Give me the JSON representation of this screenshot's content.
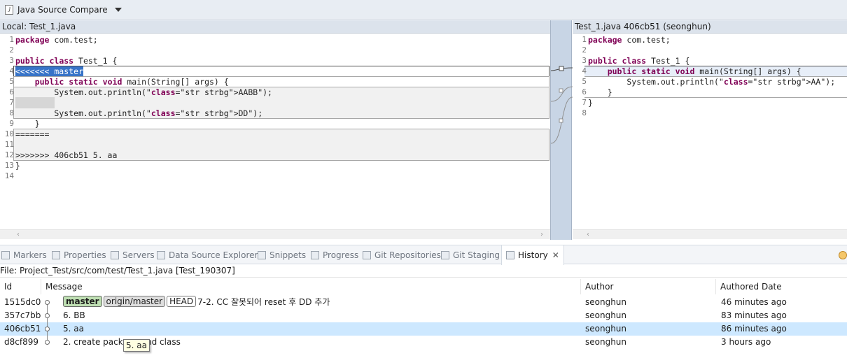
{
  "editor": {
    "title": "Java Source Compare"
  },
  "compare": {
    "left_header": "Local: Test_1.java",
    "right_header": "Test_1.java 406cb51 (seonghun)"
  },
  "left_code": [
    {
      "n": "1",
      "t": "package com.test;"
    },
    {
      "n": "2",
      "t": ""
    },
    {
      "n": "3",
      "t": "public class Test_1 {"
    },
    {
      "n": "4",
      "t": "<<<<<<< master"
    },
    {
      "n": "5",
      "t": "    public static void main(String[] args) {"
    },
    {
      "n": "6",
      "t": "        System.out.println(\"AABB\");"
    },
    {
      "n": "7",
      "t": ""
    },
    {
      "n": "8",
      "t": "        System.out.println(\"DD\");"
    },
    {
      "n": "9",
      "t": "    }"
    },
    {
      "n": "10",
      "t": "======="
    },
    {
      "n": "11",
      "t": ""
    },
    {
      "n": "12",
      "t": ">>>>>>> 406cb51 5. aa"
    },
    {
      "n": "13",
      "t": "}"
    },
    {
      "n": "14",
      "t": ""
    }
  ],
  "right_code": [
    {
      "n": "1",
      "t": "package com.test;"
    },
    {
      "n": "2",
      "t": ""
    },
    {
      "n": "3",
      "t": "public class Test_1 {"
    },
    {
      "n": "4",
      "t": "    public static void main(String[] args) {"
    },
    {
      "n": "5",
      "t": "        System.out.println(\"AA\");"
    },
    {
      "n": "6",
      "t": "    }"
    },
    {
      "n": "7",
      "t": "}"
    },
    {
      "n": "8",
      "t": ""
    }
  ],
  "view_tabs": [
    {
      "label": "Markers",
      "icon": "markers-icon"
    },
    {
      "label": "Properties",
      "icon": "properties-icon"
    },
    {
      "label": "Servers",
      "icon": "servers-icon"
    },
    {
      "label": "Data Source Explorer",
      "icon": "data-source-icon"
    },
    {
      "label": "Snippets",
      "icon": "snippets-icon"
    },
    {
      "label": "Progress",
      "icon": "progress-icon"
    },
    {
      "label": "Git Repositories",
      "icon": "git-repositories-icon"
    },
    {
      "label": "Git Staging",
      "icon": "git-staging-icon"
    },
    {
      "label": "History",
      "icon": "history-icon"
    }
  ],
  "history": {
    "file_line": "File: Project_Test/src/com/test/Test_1.java [Test_190307]",
    "columns": [
      "Id",
      "Message",
      "Author",
      "Authored Date"
    ],
    "rows": [
      {
        "id": "1515dc0",
        "refs": [
          "master",
          "origin/master",
          "HEAD"
        ],
        "message": "7-2. CC 잘못되어 reset 후 DD 추가",
        "author": "seonghun",
        "date": "46 minutes ago"
      },
      {
        "id": "357c7bb",
        "refs": [],
        "message": "6. BB",
        "author": "seonghun",
        "date": "83 minutes ago"
      },
      {
        "id": "406cb51",
        "refs": [],
        "message": "5. aa",
        "author": "seonghun",
        "date": "86 minutes ago"
      },
      {
        "id": "d8cf899",
        "refs": [],
        "message": "2. create package and class",
        "author": "seonghun",
        "date": "3 hours ago"
      }
    ],
    "selected_row": 2,
    "tooltip": "5. aa"
  },
  "colors": {
    "selection": "#cde8ff",
    "master_badge": "#bfe0b3",
    "conflict_highlight": "#3874c8"
  }
}
